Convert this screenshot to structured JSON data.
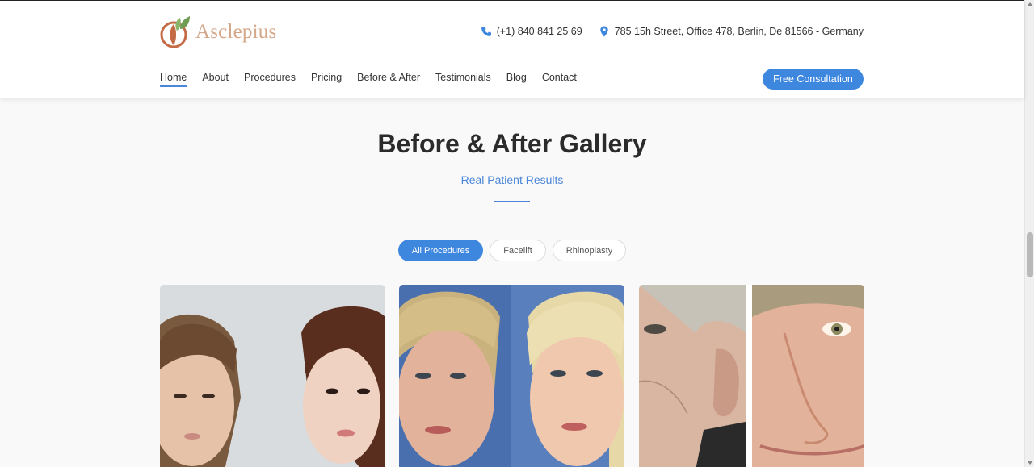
{
  "brand": {
    "name": "Asclepius",
    "logo_icon": "leaf-logo-icon"
  },
  "header": {
    "phone": "(+1) 840 841 25 69",
    "address": "785 15h Street, Office 478, Berlin, De 81566 - Germany",
    "phone_icon": "phone-icon",
    "address_icon": "map-pin-icon"
  },
  "nav": {
    "items": [
      {
        "label": "Home",
        "active": true
      },
      {
        "label": "About"
      },
      {
        "label": "Procedures"
      },
      {
        "label": "Pricing"
      },
      {
        "label": "Before & After"
      },
      {
        "label": "Testimonials"
      },
      {
        "label": "Blog"
      },
      {
        "label": "Contact"
      }
    ],
    "cta_label": "Free Consultation"
  },
  "gallery": {
    "title": "Before & After Gallery",
    "subtitle": "Real Patient Results",
    "filters": [
      {
        "label": "All Procedures",
        "active": true
      },
      {
        "label": "Facelift"
      },
      {
        "label": "Rhinoplasty"
      }
    ],
    "cards": [
      {
        "image": "before-after-photo-1"
      },
      {
        "image": "before-after-photo-2"
      },
      {
        "image": "before-after-photo-3"
      }
    ]
  },
  "colors": {
    "accent": "#3e87df",
    "brand": "#d4a789"
  }
}
